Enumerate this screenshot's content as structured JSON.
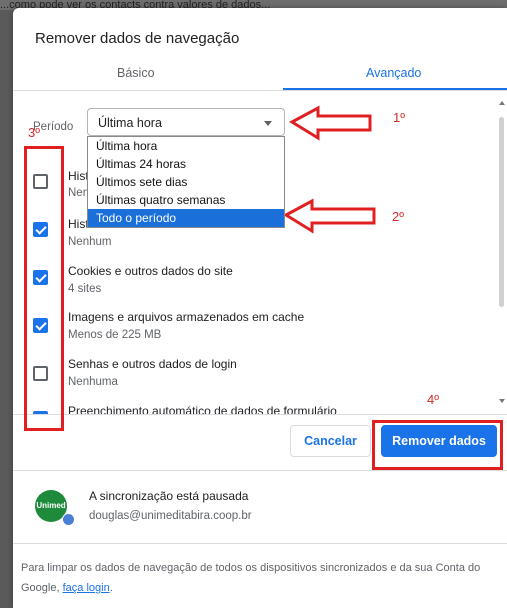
{
  "background": {
    "partial_text": "...como pode ver os contacts contra valores de dados..."
  },
  "dialog": {
    "title": "Remover dados de navegação",
    "tabs": [
      {
        "label": "Básico",
        "active": false
      },
      {
        "label": "Avançado",
        "active": true
      }
    ],
    "period": {
      "label": "Período",
      "selected": "Última hora",
      "options": [
        "Última hora",
        "Últimas 24 horas",
        "Últimos sete dias",
        "Últimas quatro semanas",
        "Todo o período"
      ],
      "highlighted_option": "Todo o período"
    },
    "items": [
      {
        "title": "Hist",
        "subtitle": "Nen",
        "checked": false
      },
      {
        "title": "Hist",
        "subtitle": "Nenhum",
        "checked": true
      },
      {
        "title": "Cookies e outros dados do site",
        "subtitle": "4 sites",
        "checked": true
      },
      {
        "title": "Imagens e arquivos armazenados em cache",
        "subtitle": "Menos de 225 MB",
        "checked": true
      },
      {
        "title": "Senhas e outros dados de login",
        "subtitle": "Nenhuma",
        "checked": false
      },
      {
        "title": "Preenchimento automático de dados de formulário",
        "subtitle": "",
        "checked": true
      }
    ],
    "buttons": {
      "cancel": "Cancelar",
      "remove": "Remover dados"
    },
    "sync": {
      "avatar_text": "Unimed",
      "title": "A sincronização está pausada",
      "email": "douglas@unimeditabira.coop.br"
    },
    "footer": {
      "text": "Para limpar os dados de navegação de todos os dispositivos sincronizados e da sua Conta do Google,",
      "link": "faça login",
      "end": "."
    }
  },
  "annotations": {
    "labels": [
      "1º",
      "2º",
      "3º",
      "4º"
    ],
    "color": "#e02020"
  },
  "colors": {
    "accent": "#1a73e8",
    "selection": "#1a6fd8",
    "annotation": "#e02020"
  }
}
